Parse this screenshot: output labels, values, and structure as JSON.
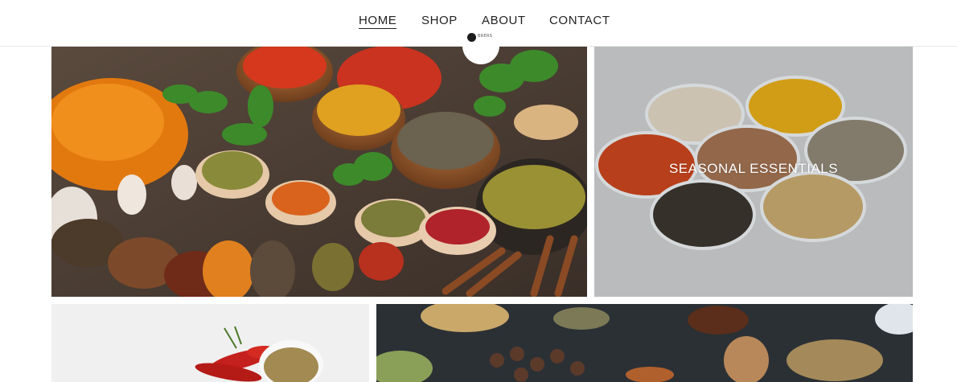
{
  "nav": {
    "items": [
      {
        "label": "HOME",
        "active": true
      },
      {
        "label": "SHOP",
        "active": false
      },
      {
        "label": "ABOUT",
        "active": false
      },
      {
        "label": "CONTACT",
        "active": false
      }
    ]
  },
  "logo": {
    "text": "BRERS"
  },
  "tiles": {
    "seasonal": {
      "label": "SEASONAL ESSENTIALS"
    }
  },
  "colors": {
    "nav_text": "#222222",
    "label_text": "#ffffff",
    "seasonal_bg": "#c9cbcc"
  }
}
